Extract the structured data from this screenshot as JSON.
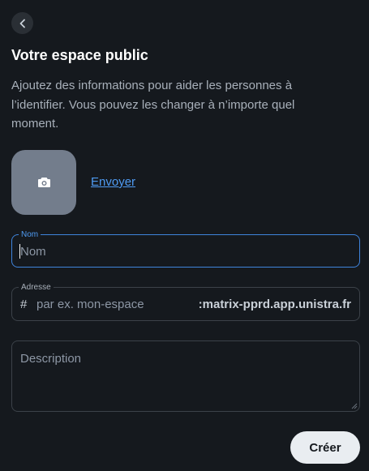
{
  "header": {
    "back_icon": "chevron-left-icon",
    "title": "Votre espace public"
  },
  "intro": {
    "description": "Ajoutez des informations pour aider les personnes à l’identifier. Vous pouvez les changer à n’importe quel moment."
  },
  "avatar": {
    "icon": "camera-icon",
    "upload_label": "Envoyer"
  },
  "form": {
    "name": {
      "legend": "Nom",
      "placeholder": "Nom",
      "value": ""
    },
    "address": {
      "legend": "Adresse",
      "prefix": "#",
      "placeholder": "par ex. mon-espace",
      "domain_suffix": ":matrix-pprd.app.unistra.fr"
    },
    "description": {
      "placeholder": "Description"
    }
  },
  "actions": {
    "create_label": "Créer"
  },
  "colors": {
    "background": "#15191e",
    "accent": "#4f9bf2",
    "focus_border": "#3f84dc",
    "button_bg": "#e9edf1"
  }
}
